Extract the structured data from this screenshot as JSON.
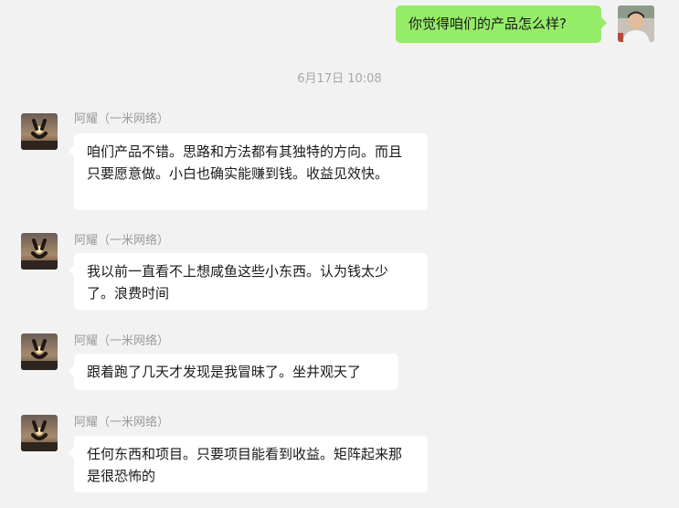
{
  "outgoing": {
    "text": "你觉得咱们的产品怎么样?"
  },
  "timestamp": "6月17日 10:08",
  "messages": [
    {
      "sender": "阿耀（一米网络）",
      "text": "咱们产品不错。思路和方法都有其独特的方向。而且只要愿意做。小白也确实能赚到钱。收益见效快。"
    },
    {
      "sender": "阿耀（一米网络）",
      "text": "我以前一直看不上想咸鱼这些小东西。认为钱太少了。浪费时间"
    },
    {
      "sender": "阿耀（一米网络）",
      "text": "跟着跑了几天才发现是我冒昧了。坐井观天了"
    },
    {
      "sender": "阿耀（一米网络）",
      "text": "任何东西和项目。只要项目能看到收益。矩阵起来那是很恐怖的"
    }
  ],
  "colors": {
    "background": "#f2f2f2",
    "self_bubble": "#95ec69",
    "other_bubble": "#ffffff",
    "meta_text": "#9a9a9a"
  },
  "icons": {
    "self_avatar": "user-photo-avatar",
    "contact_avatar": "hand-sunset-photo-avatar"
  }
}
